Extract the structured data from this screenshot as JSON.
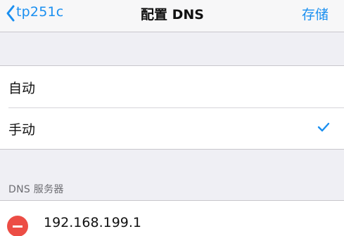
{
  "navbar": {
    "back_label": "tp251c",
    "title": "配置 DNS",
    "save_label": "存储"
  },
  "mode_options": [
    {
      "label": "自动",
      "selected": false
    },
    {
      "label": "手动",
      "selected": true
    }
  ],
  "dns_section": {
    "header": "DNS 服务器",
    "servers": [
      "192.168.199.1"
    ]
  },
  "colors": {
    "accent": "#1a8ff0",
    "destructive": "#ec4d45",
    "background": "#efeff4"
  }
}
